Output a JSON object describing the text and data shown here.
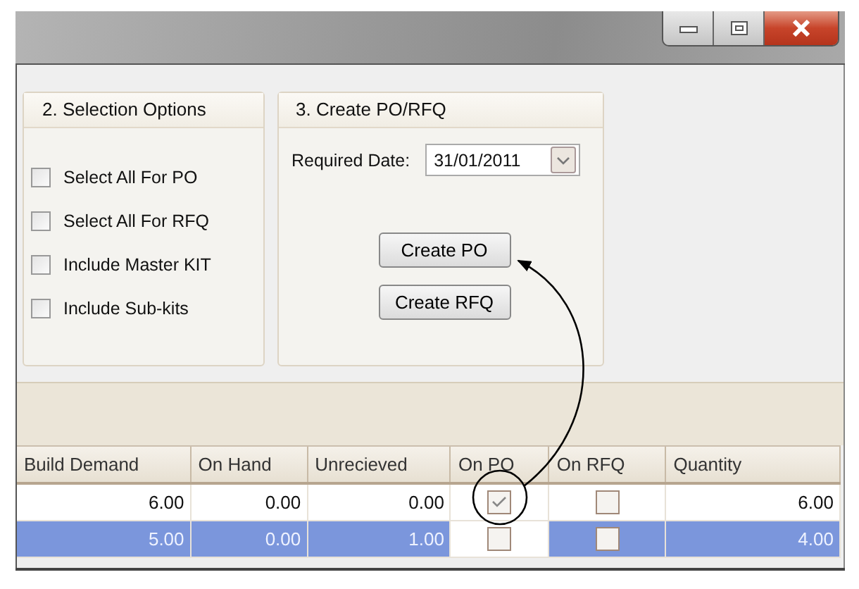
{
  "selection_options": {
    "title": "2. Selection Options",
    "options": [
      {
        "label": "Select All For PO",
        "checked": false
      },
      {
        "label": "Select All For RFQ",
        "checked": false
      },
      {
        "label": "Include Master KIT",
        "checked": false
      },
      {
        "label": "Include Sub-kits",
        "checked": false
      }
    ]
  },
  "create_panel": {
    "title": "3. Create PO/RFQ",
    "date_label": "Required Date:",
    "date_value": "31/01/2011",
    "buttons": [
      "Create PO",
      "Create RFQ"
    ]
  },
  "table": {
    "columns": [
      "Build Demand",
      "On Hand",
      "Unrecieved",
      "On PO",
      "On RFQ",
      "Quantity"
    ],
    "rows": [
      {
        "cells": [
          {
            "kind": "number",
            "text": "6.00",
            "selected": false
          },
          {
            "kind": "number",
            "text": "0.00",
            "selected": false
          },
          {
            "kind": "number",
            "text": "0.00",
            "selected": false
          },
          {
            "kind": "checkbox",
            "checked": true,
            "selected": false
          },
          {
            "kind": "checkbox",
            "checked": false,
            "selected": false
          },
          {
            "kind": "number",
            "text": "6.00",
            "selected": false
          }
        ]
      },
      {
        "cells": [
          {
            "kind": "number",
            "text": "5.00",
            "selected": true
          },
          {
            "kind": "number",
            "text": "0.00",
            "selected": true
          },
          {
            "kind": "number",
            "text": "1.00",
            "selected": true
          },
          {
            "kind": "checkbox",
            "checked": false,
            "selected": false
          },
          {
            "kind": "checkbox",
            "checked": false,
            "selected": true
          },
          {
            "kind": "number",
            "text": "4.00",
            "selected": true
          }
        ]
      }
    ]
  }
}
